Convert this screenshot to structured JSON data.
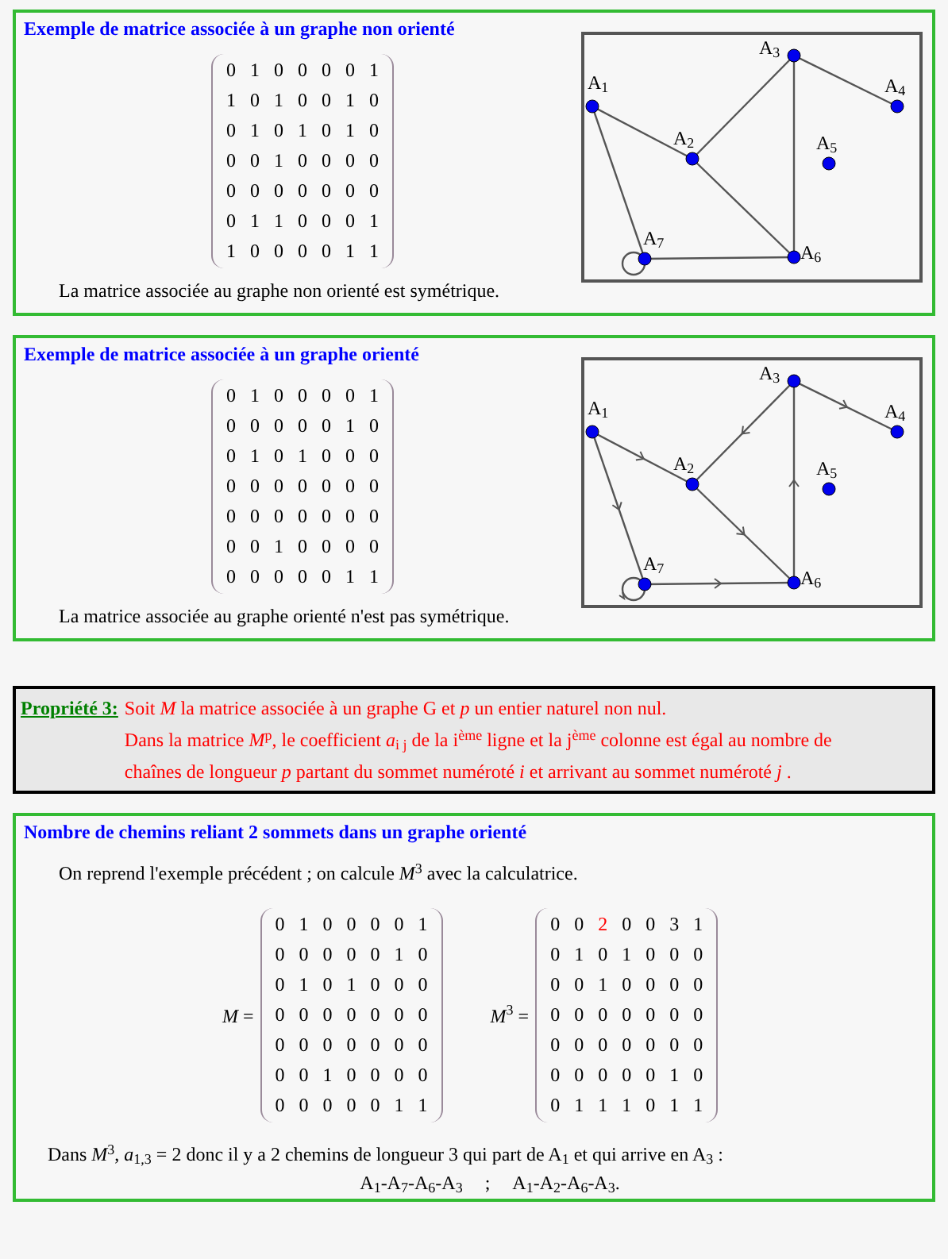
{
  "sections": [
    {
      "kind": "example",
      "title": "Exemple de matrice associée à un graphe non orienté",
      "matrix": [
        [
          "0",
          "1",
          "0",
          "0",
          "0",
          "0",
          "1"
        ],
        [
          "1",
          "0",
          "1",
          "0",
          "0",
          "1",
          "0"
        ],
        [
          "0",
          "1",
          "0",
          "1",
          "0",
          "1",
          "0"
        ],
        [
          "0",
          "0",
          "1",
          "0",
          "0",
          "0",
          "0"
        ],
        [
          "0",
          "0",
          "0",
          "0",
          "0",
          "0",
          "0"
        ],
        [
          "0",
          "1",
          "1",
          "0",
          "0",
          "0",
          "1"
        ],
        [
          "1",
          "0",
          "0",
          "0",
          "0",
          "1",
          "1"
        ]
      ],
      "graph": {
        "directed": false,
        "nodes": [
          "A$_{1}$",
          "A$_{2}$",
          "A$_{3}$",
          "A$_{4}$",
          "A$_{5}$",
          "A$_{6}$",
          "A$_{7}$"
        ]
      },
      "note": "La matrice associée au graphe non orienté est symétrique."
    },
    {
      "kind": "example",
      "title": "Exemple de matrice associée à un graphe orienté",
      "matrix": [
        [
          "0",
          "1",
          "0",
          "0",
          "0",
          "0",
          "1"
        ],
        [
          "0",
          "0",
          "0",
          "0",
          "0",
          "1",
          "0"
        ],
        [
          "0",
          "1",
          "0",
          "1",
          "0",
          "0",
          "0"
        ],
        [
          "0",
          "0",
          "0",
          "0",
          "0",
          "0",
          "0"
        ],
        [
          "0",
          "0",
          "0",
          "0",
          "0",
          "0",
          "0"
        ],
        [
          "0",
          "0",
          "1",
          "0",
          "0",
          "0",
          "0"
        ],
        [
          "0",
          "0",
          "0",
          "0",
          "0",
          "1",
          "1"
        ]
      ],
      "graph": {
        "directed": true,
        "nodes": [
          "A$_{1}$",
          "A$_{2}$",
          "A$_{3}$",
          "A$_{4}$",
          "A$_{5}$",
          "A$_{6}$",
          "A$_{7}$"
        ]
      },
      "note": "La matrice associée au graphe orienté n'est pas symétrique."
    },
    {
      "kind": "property",
      "label": "Propriété 3:",
      "lines": [
        "Soit *M* la matrice associée à un graphe G et *p* un entier naturel non nul.",
        "Dans la matrice *M*$^{p}$, le coefficient *a*$_{i j}$ de la i$^{ème}$ ligne et la j$^{ème}$ colonne est égal au nombre de",
        "chaînes de longueur *p* partant du sommet numéroté *i* et arrivant au sommet numéroté *j* ."
      ]
    },
    {
      "kind": "paths",
      "title": "Nombre de chemins reliant 2 sommets dans un graphe orienté",
      "intro": "On reprend l'exemple précédent ; on calcule *M*$^{3}$ avec la calculatrice.",
      "matrices": [
        {
          "label": "*M* =",
          "rows": [
            [
              "0",
              "1",
              "0",
              "0",
              "0",
              "0",
              "1"
            ],
            [
              "0",
              "0",
              "0",
              "0",
              "0",
              "1",
              "0"
            ],
            [
              "0",
              "1",
              "0",
              "1",
              "0",
              "0",
              "0"
            ],
            [
              "0",
              "0",
              "0",
              "0",
              "0",
              "0",
              "0"
            ],
            [
              "0",
              "0",
              "0",
              "0",
              "0",
              "0",
              "0"
            ],
            [
              "0",
              "0",
              "1",
              "0",
              "0",
              "0",
              "0"
            ],
            [
              "0",
              "0",
              "0",
              "0",
              "0",
              "1",
              "1"
            ]
          ]
        },
        {
          "label": "*M*$^{3}$ =",
          "rows": [
            [
              "0",
              "0",
              {
                "value": "2",
                "highlighted": true
              },
              "0",
              "0",
              "3",
              "1"
            ],
            [
              "0",
              "1",
              "0",
              "1",
              "0",
              "0",
              "0"
            ],
            [
              "0",
              "0",
              "1",
              "0",
              "0",
              "0",
              "0"
            ],
            [
              "0",
              "0",
              "0",
              "0",
              "0",
              "0",
              "0"
            ],
            [
              "0",
              "0",
              "0",
              "0",
              "0",
              "0",
              "0"
            ],
            [
              "0",
              "0",
              "0",
              "0",
              "0",
              "1",
              "0"
            ],
            [
              "0",
              "1",
              "1",
              "1",
              "0",
              "1",
              "1"
            ]
          ]
        }
      ],
      "conclusion": "Dans *M*$^{3}$, *a*$_{1,3}$ = 2  donc il y a 2 chemins de longueur 3 qui part de A$_{1}$ et qui arrive en A$_{3}$ :",
      "paths": [
        "A$_{1}$-A$_{7}$-A$_{6}$-A$_{3}$",
        ";",
        "A$_{1}$-A$_{2}$-A$_{6}$-A$_{3}$."
      ]
    }
  ]
}
